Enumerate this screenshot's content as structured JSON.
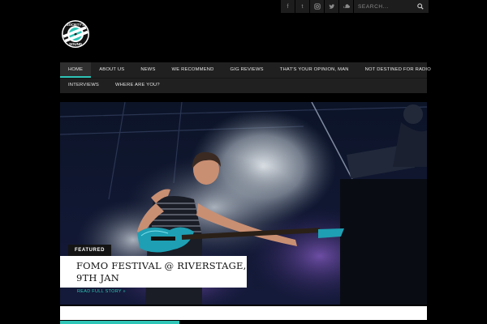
{
  "topbar": {
    "social": [
      {
        "name": "facebook-icon",
        "glyph": "f"
      },
      {
        "name": "tumblr-icon",
        "glyph": "t"
      },
      {
        "name": "instagram-icon",
        "glyph": "◘"
      },
      {
        "name": "twitter-icon",
        "glyph": "🐦"
      },
      {
        "name": "soundcloud-icon",
        "glyph": "☁"
      }
    ],
    "search_placeholder": "SEARCH..."
  },
  "logo": {
    "top_text": "SOCIETY'S",
    "bottom_text": "SOUND"
  },
  "nav": {
    "row1": [
      "HOME",
      "ABOUT US",
      "NEWS",
      "WE RECOMMEND",
      "GIG REVIEWS",
      "THAT'S YOUR OPINION, MAN",
      "NOT DESTINED FOR RADIO"
    ],
    "row2": [
      "INTERVIEWS",
      "WHERE ARE YOU?"
    ],
    "active": "HOME"
  },
  "hero": {
    "tag": "FEATURED",
    "title": "FOMO FESTIVAL @ RIVERSTAGE, 9TH JAN",
    "read_more": "READ FULL STORY »"
  },
  "colors": {
    "accent": "#2ec4b6",
    "nav_bg": "#202020",
    "page_bg": "#000000"
  }
}
